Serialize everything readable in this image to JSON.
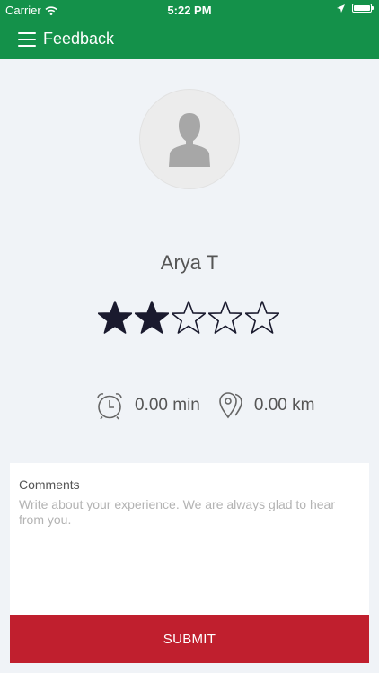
{
  "status_bar": {
    "carrier": "Carrier",
    "time": "5:22 PM"
  },
  "app_bar": {
    "title": "Feedback"
  },
  "driver": {
    "name": "Arya T",
    "rating": 2,
    "max_rating": 5
  },
  "stats": {
    "duration": "0.00 min",
    "distance": "0.00 km"
  },
  "comments": {
    "label": "Comments",
    "value": "",
    "placeholder": "Write about your experience. We are always glad to hear from you."
  },
  "submit": {
    "label": "SUBMIT"
  },
  "colors": {
    "header": "#14914a",
    "submit": "#c01f2e",
    "star": "#1a1a2e"
  }
}
